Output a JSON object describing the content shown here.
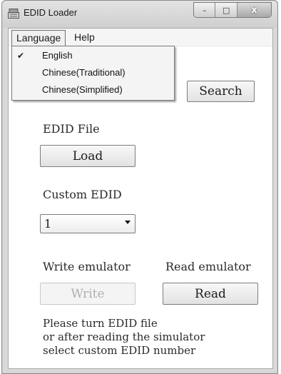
{
  "window": {
    "title": "EDID Loader",
    "caption_buttons": {
      "minimize": "–",
      "maximize": "□",
      "close": "x"
    }
  },
  "menubar": {
    "items": [
      {
        "label": "Language",
        "open": true
      },
      {
        "label": "Help",
        "open": false
      }
    ]
  },
  "language_menu": {
    "items": [
      {
        "label": "English",
        "checked": true,
        "check_glyph": "✔"
      },
      {
        "label": "Chinese(Traditional)",
        "checked": false
      },
      {
        "label": "Chinese(Simplified)",
        "checked": false
      }
    ]
  },
  "search": {
    "button_label": "Search"
  },
  "edid_file": {
    "label": "EDID File",
    "load_button_label": "Load"
  },
  "custom_edid": {
    "label": "Custom EDID",
    "selected_value": "1"
  },
  "emulator": {
    "write_label": "Write emulator",
    "write_button_label": "Write",
    "write_enabled": false,
    "read_label": "Read emulator",
    "read_button_label": "Read"
  },
  "info_text": {
    "lines": [
      "Please turn EDID file",
      "or after reading the simulator",
      "select custom EDID number"
    ]
  },
  "icons": {
    "app_icon": "edid-loader-app-icon",
    "dropdown_arrow": "chevron-down-icon",
    "check": "check-icon"
  },
  "colors": {
    "window_frame": "#d9d9d9",
    "client_background": "#ffffff",
    "menu_background": "#f4f4f4",
    "disabled_text": "#b0b0b0"
  }
}
